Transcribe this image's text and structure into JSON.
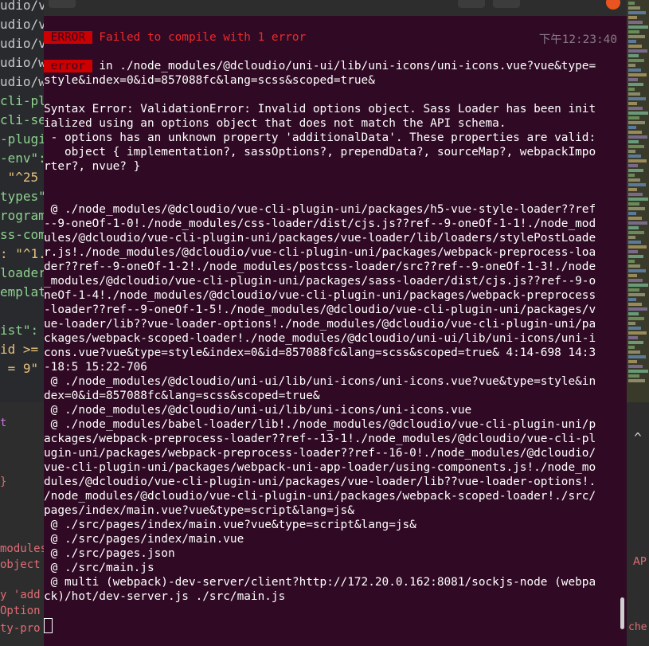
{
  "editor_left": {
    "upper_lines": [
      {
        "text": "udio/v",
        "color": "#c8c8c8"
      },
      {
        "text": "udio/v",
        "color": "#c8c8c8"
      },
      {
        "text": "udio/v",
        "color": "#c8c8c8"
      },
      {
        "text": "udio/w",
        "color": "#c8c8c8"
      },
      {
        "text": "udio/w",
        "color": "#c8c8c8"
      },
      {
        "text": "cli-pl",
        "color": "#8fd18f"
      },
      {
        "text": "cli-se",
        "color": "#8fd18f"
      },
      {
        "text": "-plugi",
        "color": "#8fd18f"
      },
      {
        "text": "-env\":",
        "color": "#8fd18f"
      },
      {
        "text": " \"^25",
        "color": "#e6c07b"
      },
      {
        "text": "types\"",
        "color": "#8fd18f"
      },
      {
        "text": "rogram",
        "color": "#8fd18f"
      },
      {
        "text": "ss-com",
        "color": "#8fd18f"
      },
      {
        "text": ": \"^1.",
        "color": "#e6c07b"
      },
      {
        "text": "loader",
        "color": "#8fd18f"
      },
      {
        "text": "emplat",
        "color": "#8fd18f"
      },
      {
        "text": "",
        "color": "#c8c8c8"
      },
      {
        "text": "ist\":",
        "color": "#8fd18f"
      },
      {
        "text": "id >=",
        "color": "#e6c07b"
      },
      {
        "text": " = 9\"",
        "color": "#e6c07b"
      }
    ],
    "lower_lines": [
      {
        "text": "t",
        "color": "#c678dd"
      },
      {
        "text": "}",
        "color": "#e06c75"
      },
      {
        "text": "modules",
        "color": "#e06c75"
      },
      {
        "text": "object",
        "color": "#e06c75"
      },
      {
        "text": "y 'add",
        "color": "#e06c75"
      },
      {
        "text": "Option",
        "color": "#e06c75"
      },
      {
        "text": "ty-pro",
        "color": "#e06c75"
      }
    ]
  },
  "editor_right": {
    "chevron": "^",
    "api_label": "AP",
    "che_label": "che"
  },
  "terminal": {
    "timestamp": "下午12:23:40",
    "lines": [
      {
        "tag": "ERROR",
        "rest": " Failed to compile with 1 error",
        "rest_red": true
      },
      {
        "blank": true
      },
      {
        "tag": "error",
        "rest": " in ./node_modules/@dcloudio/uni-ui/lib/uni-icons/uni-icons.vue?vue&type="
      },
      {
        "text": "style&index=0&id=857088fc&lang=scss&scoped=true&"
      },
      {
        "blank": true
      },
      {
        "text": "Syntax Error: ValidationError: Invalid options object. Sass Loader has been init"
      },
      {
        "text": "ialized using an options object that does not match the API schema."
      },
      {
        "text": " - options has an unknown property 'additionalData'. These properties are valid:"
      },
      {
        "text": "   object { implementation?, sassOptions?, prependData?, sourceMap?, webpackImpo"
      },
      {
        "text": "rter?, nvue? }"
      },
      {
        "blank": true
      },
      {
        "blank": true
      },
      {
        "text": " @ ./node_modules/@dcloudio/vue-cli-plugin-uni/packages/h5-vue-style-loader??ref"
      },
      {
        "text": "--9-oneOf-1-0!./node_modules/css-loader/dist/cjs.js??ref--9-oneOf-1-1!./node_mod"
      },
      {
        "text": "ules/@dcloudio/vue-cli-plugin-uni/packages/vue-loader/lib/loaders/stylePostLoade"
      },
      {
        "text": "r.js!./node_modules/@dcloudio/vue-cli-plugin-uni/packages/webpack-preprocess-loa"
      },
      {
        "text": "der??ref--9-oneOf-1-2!./node_modules/postcss-loader/src??ref--9-oneOf-1-3!./node"
      },
      {
        "text": "_modules/@dcloudio/vue-cli-plugin-uni/packages/sass-loader/dist/cjs.js??ref--9-o"
      },
      {
        "text": "neOf-1-4!./node_modules/@dcloudio/vue-cli-plugin-uni/packages/webpack-preprocess"
      },
      {
        "text": "-loader??ref--9-oneOf-1-5!./node_modules/@dcloudio/vue-cli-plugin-uni/packages/v"
      },
      {
        "text": "ue-loader/lib??vue-loader-options!./node_modules/@dcloudio/vue-cli-plugin-uni/pa"
      },
      {
        "text": "ckages/webpack-scoped-loader!./node_modules/@dcloudio/uni-ui/lib/uni-icons/uni-i"
      },
      {
        "text": "cons.vue?vue&type=style&index=0&id=857088fc&lang=scss&scoped=true& 4:14-698 14:3"
      },
      {
        "text": "-18:5 15:22-706"
      },
      {
        "text": " @ ./node_modules/@dcloudio/uni-ui/lib/uni-icons/uni-icons.vue?vue&type=style&in"
      },
      {
        "text": "dex=0&id=857088fc&lang=scss&scoped=true&"
      },
      {
        "text": " @ ./node_modules/@dcloudio/uni-ui/lib/uni-icons/uni-icons.vue"
      },
      {
        "text": " @ ./node_modules/babel-loader/lib!./node_modules/@dcloudio/vue-cli-plugin-uni/p"
      },
      {
        "text": "ackages/webpack-preprocess-loader??ref--13-1!./node_modules/@dcloudio/vue-cli-pl"
      },
      {
        "text": "ugin-uni/packages/webpack-preprocess-loader??ref--16-0!./node_modules/@dcloudio/"
      },
      {
        "text": "vue-cli-plugin-uni/packages/webpack-uni-app-loader/using-components.js!./node_mo"
      },
      {
        "text": "dules/@dcloudio/vue-cli-plugin-uni/packages/vue-loader/lib??vue-loader-options!."
      },
      {
        "text": "/node_modules/@dcloudio/vue-cli-plugin-uni/packages/webpack-scoped-loader!./src/"
      },
      {
        "text": "pages/index/main.vue?vue&type=script&lang=js&"
      },
      {
        "text": " @ ./src/pages/index/main.vue?vue&type=script&lang=js&"
      },
      {
        "text": " @ ./src/pages/index/main.vue"
      },
      {
        "text": " @ ./src/pages.json"
      },
      {
        "text": " @ ./src/main.js"
      },
      {
        "text": " @ multi (webpack)-dev-server/client?http://172.20.0.162:8081/sockjs-node (webpa"
      },
      {
        "text": "ck)/hot/dev-server.js ./src/main.js"
      },
      {
        "blank": true
      },
      {
        "cursor": true
      }
    ]
  },
  "colors": {
    "terminal_bg": "#300a24",
    "error_bg": "#cc0000",
    "error_text": "#ef2929"
  }
}
